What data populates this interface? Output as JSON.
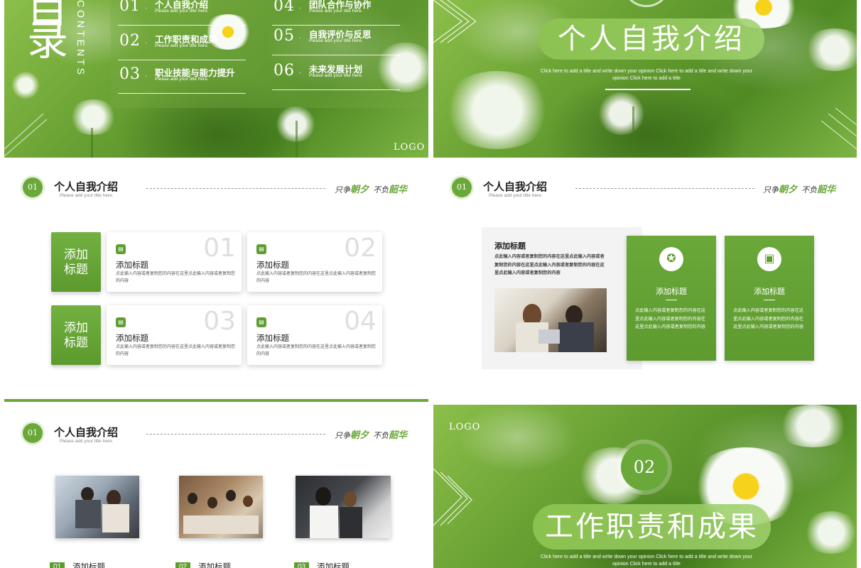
{
  "slide1": {
    "big_char_1": "目",
    "big_char_2": "录",
    "vertical_label": "CONTENTS",
    "logo": "LOGO",
    "items": [
      {
        "num": "01",
        "title": "个人自我介绍",
        "sub": "Please add your title here."
      },
      {
        "num": "02",
        "title": "工作职责和成果",
        "sub": "Please add your title here."
      },
      {
        "num": "03",
        "title": "职业技能与能力提升",
        "sub": "Please add your title here."
      },
      {
        "num": "04",
        "title": "团队合作与协作",
        "sub": "Please add your title here."
      },
      {
        "num": "05",
        "title": "自我评价与反思",
        "sub": "Please add your title here."
      },
      {
        "num": "06",
        "title": "未来发展计划",
        "sub": "Please add your title here."
      }
    ]
  },
  "slide2": {
    "title": "个人自我介绍",
    "sub": "Click here to add a title and write down your opinion Click here to add a title and write down your opinion Click here to add a title"
  },
  "header": {
    "badge": "01",
    "title": "个人自我介绍",
    "sub": "Please add your title here.",
    "motto_a": "只争",
    "motto_b": "朝夕",
    "motto_c": "不负",
    "motto_d": "韶华"
  },
  "slide3": {
    "tabs": [
      "添加\n标题",
      "添加\n标题"
    ],
    "tab_a": "添加",
    "tab_b": "标题",
    "cards": [
      {
        "num": "01",
        "title": "添加标题",
        "body": "点此输入内容或者复制您的内容在这里点此输入内容或者复制您的内容"
      },
      {
        "num": "02",
        "title": "添加标题",
        "body": "点此输入内容或者复制您的内容在这里点此输入内容或者复制您的内容"
      },
      {
        "num": "03",
        "title": "添加标题",
        "body": "点此输入内容或者复制您的内容在这里点此输入内容或者复制您的内容"
      },
      {
        "num": "04",
        "title": "添加标题",
        "body": "点此输入内容或者复制您的内容在这里点此输入内容或者复制您的内容"
      }
    ]
  },
  "slide4": {
    "box_title": "添加标题",
    "box_body": "点此输入内容或者复制您的内容在这里点此输入内容或者复制您的内容在这里点此输入内容或者复制您的内容在这里点此输入内容或者复制您的内容",
    "green_cards": [
      {
        "icon": "medal-icon",
        "title": "添加标题",
        "body": "点此输入内容或者复制您的内容在这里点此输入内容或者复制您的内容在这里点此输入内容或者复制您的内容"
      },
      {
        "icon": "presentation-icon",
        "title": "添加标题",
        "body": "点此输入内容或者复制您的内容在这里点此输入内容或者复制您的内容在这里点此输入内容或者复制您的内容"
      }
    ]
  },
  "slide5": {
    "items": [
      {
        "num": "01",
        "label": "添加标题"
      },
      {
        "num": "02",
        "label": "添加标题"
      },
      {
        "num": "03",
        "label": "添加标题"
      }
    ]
  },
  "slide6": {
    "logo": "LOGO",
    "num": "02",
    "title": "工作职责和成果",
    "sub": "Click here to add a title and write down your opinion Click here to add a title and write down your opinion Click here to add a title"
  },
  "colors": {
    "accent": "#6aa83a",
    "accent_dark": "#5e9e31",
    "text_dark": "#222222"
  }
}
